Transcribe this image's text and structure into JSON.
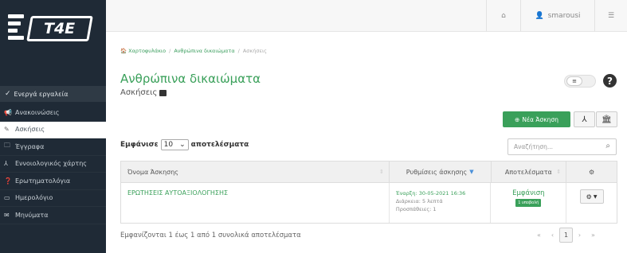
{
  "logo": {
    "text": "T4E"
  },
  "topbar": {
    "home_icon": "home-icon",
    "user_icon": "user-icon",
    "username": "smarousi",
    "menu_icon": "sliders-icon"
  },
  "sidebar": {
    "section_label": "Ενεργά εργαλεία",
    "items": [
      {
        "icon": "megaphone-icon",
        "glyph": "📢",
        "label": "Ανακοινώσεις",
        "active": false
      },
      {
        "icon": "edit-icon",
        "glyph": "✎",
        "label": "Ασκήσεις",
        "active": true
      },
      {
        "icon": "folder-icon",
        "glyph": "🗀",
        "label": "Έγγραφα",
        "active": false
      },
      {
        "icon": "sitemap-icon",
        "glyph": "⅄",
        "label": "Εννοιολογικός χάρτης",
        "active": false
      },
      {
        "icon": "question-icon",
        "glyph": "❓",
        "label": "Ερωτηματολόγια",
        "active": false
      },
      {
        "icon": "calendar-icon",
        "glyph": "▭",
        "label": "Ημερολόγιο",
        "active": false
      },
      {
        "icon": "envelope-icon",
        "glyph": "✉",
        "label": "Μηνύματα",
        "active": false
      }
    ]
  },
  "breadcrumb": {
    "home": "Χαρτοφυλάκιο",
    "course": "Ανθρώπινα δικαιώματα",
    "current": "Ασκήσεις"
  },
  "page": {
    "title": "Ανθρώπινα δικαιώματα",
    "subtitle": "Ασκήσεις"
  },
  "actions": {
    "new_exercise": "Νέα Άσκηση"
  },
  "length_menu": {
    "prefix": "Εμφάνισε",
    "value": "10",
    "suffix": "αποτελέσματα"
  },
  "search": {
    "placeholder": "Αναζήτηση..."
  },
  "table": {
    "headers": {
      "name": "Όνομα Άσκησης",
      "settings": "Ρυθμίσεις άσκησης",
      "results": "Αποτελέσματα"
    },
    "rows": [
      {
        "name": "ΕΡΩΤΗΣΕΙΣ ΑΥΤΟΑΞΙΟΛΟΓΗΣΗΣ",
        "start": "Έναρξη: 30-05-2021 16:36",
        "duration": "Διάρκεια: 5 λεπτά",
        "attempts": "Προσπάθειες: 1",
        "result_link": "Εμφάνιση",
        "result_badge": "1 υποβολή"
      }
    ]
  },
  "footer": {
    "info": "Εμφανίζονται 1 έως 1 από 1 συνολικά αποτελέσματα"
  },
  "pagination": {
    "current": "1"
  }
}
